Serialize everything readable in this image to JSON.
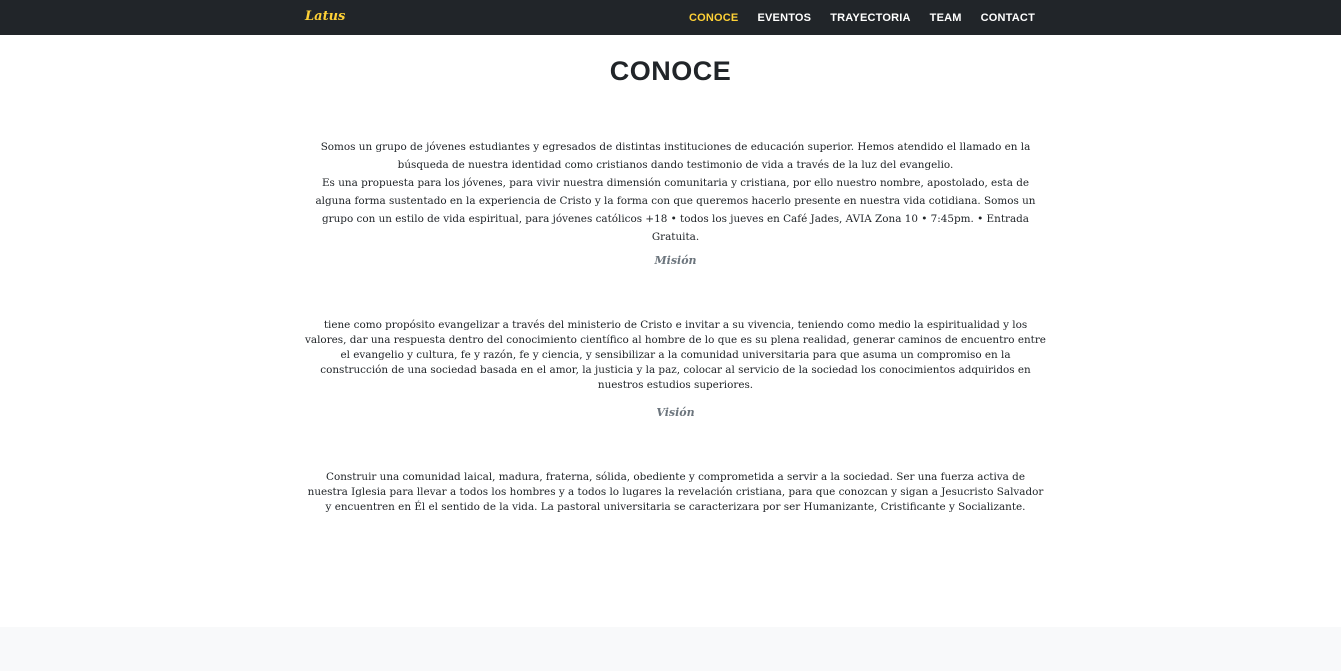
{
  "navbar": {
    "brand": "Latus",
    "items": [
      {
        "label": "CONOCE"
      },
      {
        "label": "EVENTOS"
      },
      {
        "label": "TRAYECTORIA"
      },
      {
        "label": "TEAM"
      },
      {
        "label": "CONTACT"
      }
    ]
  },
  "section": {
    "title": "CONOCE",
    "intro_1": "Somos un grupo de jóvenes estudiantes y egresados de distintas instituciones de educación superior. Hemos atendido el llamado en la búsqueda de nuestra identidad como cristianos dando testimonio de vida a través de la luz del evangelio.",
    "intro_2": "Es una propuesta para los jóvenes, para vivir nuestra dimensión comunitaria y cristiana, por ello nuestro nombre, apostolado, esta de alguna forma sustentado en la experiencia de Cristo y la forma con que queremos hacerlo presente en nuestra vida cotidiana. Somos un grupo con un estilo de vida espiritual, para jóvenes católicos +18 • todos los jueves en Café Jades, AVIA Zona 10 • 7:45pm. • Entrada Gratuita.",
    "mision_heading": "Misión",
    "mision_text": "tiene como propósito evangelizar a través del ministerio de Cristo e invitar a su vivencia, teniendo como medio la espiritualidad y los valores, dar una respuesta dentro del conocimiento científico al hombre de lo que es su plena realidad, generar caminos de encuentro entre el evangelio y cultura, fe y razón, fe y ciencia, y sensibilizar a la comunidad universitaria para que asuma un compromiso en la construcción de una sociedad basada en el amor, la justicia y la paz, colocar al servicio de la sociedad los conocimientos adquiridos en nuestros estudios superiores.",
    "vision_heading": "Visión",
    "vision_text": "Construir una comunidad laical, madura, fraterna, sólida, obediente y comprometida a servir a la sociedad. Ser una fuerza activa de nuestra Iglesia para llevar a todos los hombres y a todos lo lugares la revelación cristiana, para que conozcan y sigan a Jesucristo Salvador y encuentren en Él el sentido de la vida. La pastoral universitaria se caracterizara por ser Humanizante, Cristificante y Socializante."
  },
  "colors": {
    "navbar_bg": "#212529",
    "accent": "#fed136",
    "muted": "#6c757d",
    "footer_bg": "#f8f9fa"
  }
}
